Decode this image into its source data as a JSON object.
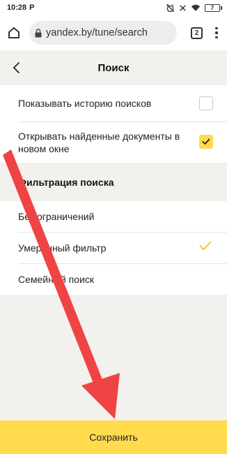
{
  "status_bar": {
    "time": "10:28",
    "notification": "P",
    "battery": "7"
  },
  "browser": {
    "url": "yandex.by/tune/search",
    "tab_count": "2"
  },
  "header": {
    "title": "Поиск"
  },
  "settings": {
    "history": {
      "label": "Показывать историю поисков",
      "checked": false
    },
    "new_window": {
      "label": "Открывать найденные документы в новом окне",
      "checked": true
    }
  },
  "filter": {
    "section_title": "Фильтрация поиска",
    "options": [
      {
        "label": "Без ограничений",
        "selected": false
      },
      {
        "label": "Умеренный фильтр",
        "selected": true
      },
      {
        "label": "Семейный поиск",
        "selected": false
      }
    ]
  },
  "save_label": "Сохранить",
  "colors": {
    "accent": "#ffdb4d",
    "arrow": "#ef4444",
    "panel_bg": "#f2f1ed"
  }
}
